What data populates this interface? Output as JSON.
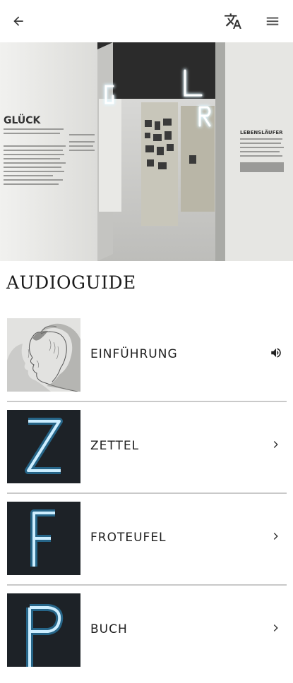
{
  "header": {
    "back_icon": "arrow-left-icon",
    "translate_icon": "translate-icon",
    "menu_icon": "hamburger-menu-icon"
  },
  "hero": {
    "description": "Exhibition hall photo",
    "wall_text": "GLÜCK",
    "sign_text": "LEBENSLÄUFER"
  },
  "section": {
    "title": "AUDIOGUIDE"
  },
  "items": [
    {
      "label": "EINFÜHRUNG",
      "trailing_icon": "speaker-icon",
      "thumb": "portrait"
    },
    {
      "label": "ZETTEL",
      "trailing_icon": "chevron-right-icon",
      "thumb": "neon-Z"
    },
    {
      "label": "FROTEUFEL",
      "trailing_icon": "chevron-right-icon",
      "thumb": "neon-F"
    },
    {
      "label": "BUCH",
      "trailing_icon": "chevron-right-icon",
      "thumb": "neon-B"
    }
  ],
  "colors": {
    "neon": "#bfe9ff",
    "neon_glow": "#34b7ff",
    "divider": "#c9c9c9"
  }
}
